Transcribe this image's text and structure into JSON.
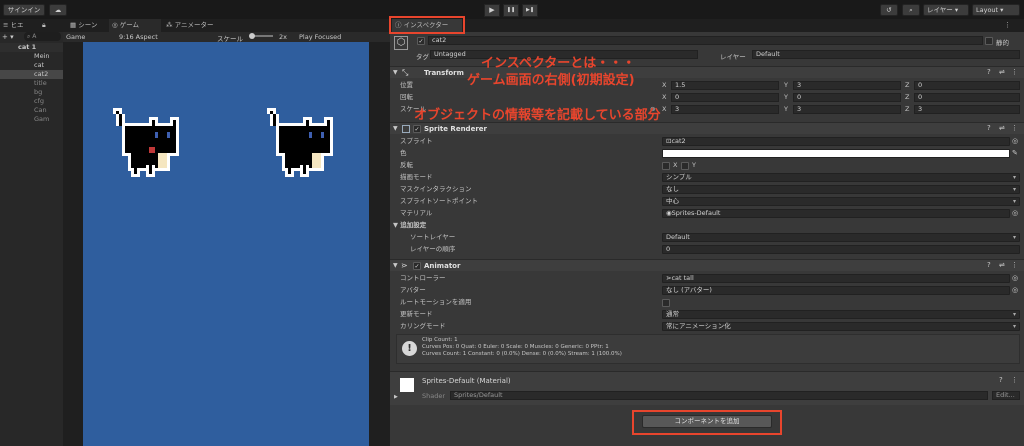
{
  "toolbar": {
    "signin": "サインイン",
    "cloud_icon": "cloud-icon",
    "play": "▶",
    "pause": "❚❚",
    "step": "▶❚",
    "layers": "レイヤー",
    "layout": "Layout"
  },
  "tabs": {
    "hierarchy": "ヒエ",
    "scene": "シーン",
    "game": "ゲーム",
    "animator": "アニメーター",
    "inspector": "インスペクター"
  },
  "hierarchy": {
    "add": "+ ▾",
    "search": "A",
    "scene": "cat 1",
    "items": [
      "Mein",
      "cat",
      "cat2",
      "title",
      "bg",
      "cfg",
      "Can",
      "Gam"
    ]
  },
  "gamebar": {
    "display": "Game",
    "aspect": "9:16 Aspect",
    "scale_label": "スケール",
    "scale_value": "2x",
    "play_mode": "Play Focused"
  },
  "object": {
    "name": "cat2",
    "static": "静的",
    "tag_label": "タグ",
    "tag": "Untagged",
    "layer_label": "レイヤー",
    "layer": "Default"
  },
  "transform": {
    "title": "Transform",
    "position": "位置",
    "rotation": "回転",
    "scale": "スケール",
    "pos": [
      "1.5",
      "3",
      "0"
    ],
    "rot": [
      "0",
      "0",
      "0"
    ],
    "scl": [
      "3",
      "3",
      "3"
    ]
  },
  "sprite_renderer": {
    "title": "Sprite Renderer",
    "sprite_label": "スプライト",
    "sprite": "cat2",
    "color_label": "色",
    "flip_label": "反転",
    "flip_x": "X",
    "flip_y": "Y",
    "draw_mode_label": "描画モード",
    "draw_mode": "シンプル",
    "mask_label": "マスクインタラクション",
    "mask": "なし",
    "sort_point_label": "スプライトソートポイント",
    "sort_point": "中心",
    "material_label": "マテリアル",
    "material": "Sprites-Default",
    "additional": "追加設定",
    "sorting_layer_label": "ソートレイヤー",
    "sorting_layer": "Default",
    "order_label": "レイヤーの順序",
    "order": "0"
  },
  "animator": {
    "title": "Animator",
    "controller_label": "コントローラー",
    "controller": "cat tall",
    "avatar_label": "アバター",
    "avatar": "なし (アバター)",
    "root_motion_label": "ルートモーションを適用",
    "update_label": "更新モード",
    "update": "通常",
    "culling_label": "カリングモード",
    "culling": "常にアニメーション化",
    "info1": "Clip Count: 1",
    "info2": "Curves Pos: 0 Quat: 0 Euler: 0 Scale: 0 Muscles: 0 Generic: 0 PPtr: 1",
    "info3": "Curves Count: 1 Constant: 0 (0.0%) Dense: 0 (0.0%) Stream: 1 (100.0%)"
  },
  "material": {
    "name": "Sprites-Default (Material)",
    "shader_label": "Shader",
    "shader": "Sprites/Default",
    "edit": "Edit..."
  },
  "add_component": "コンポーネントを追加",
  "annotations": {
    "line1": "インスペクターとは・・・",
    "line2": "ゲーム画面の右側",
    "line2b": "(初期設定)",
    "line3": "オブジェクトの情報等を記載している部分"
  },
  "colors": {
    "accent": "#e8452d",
    "game_bg": "#2f5e9e"
  }
}
